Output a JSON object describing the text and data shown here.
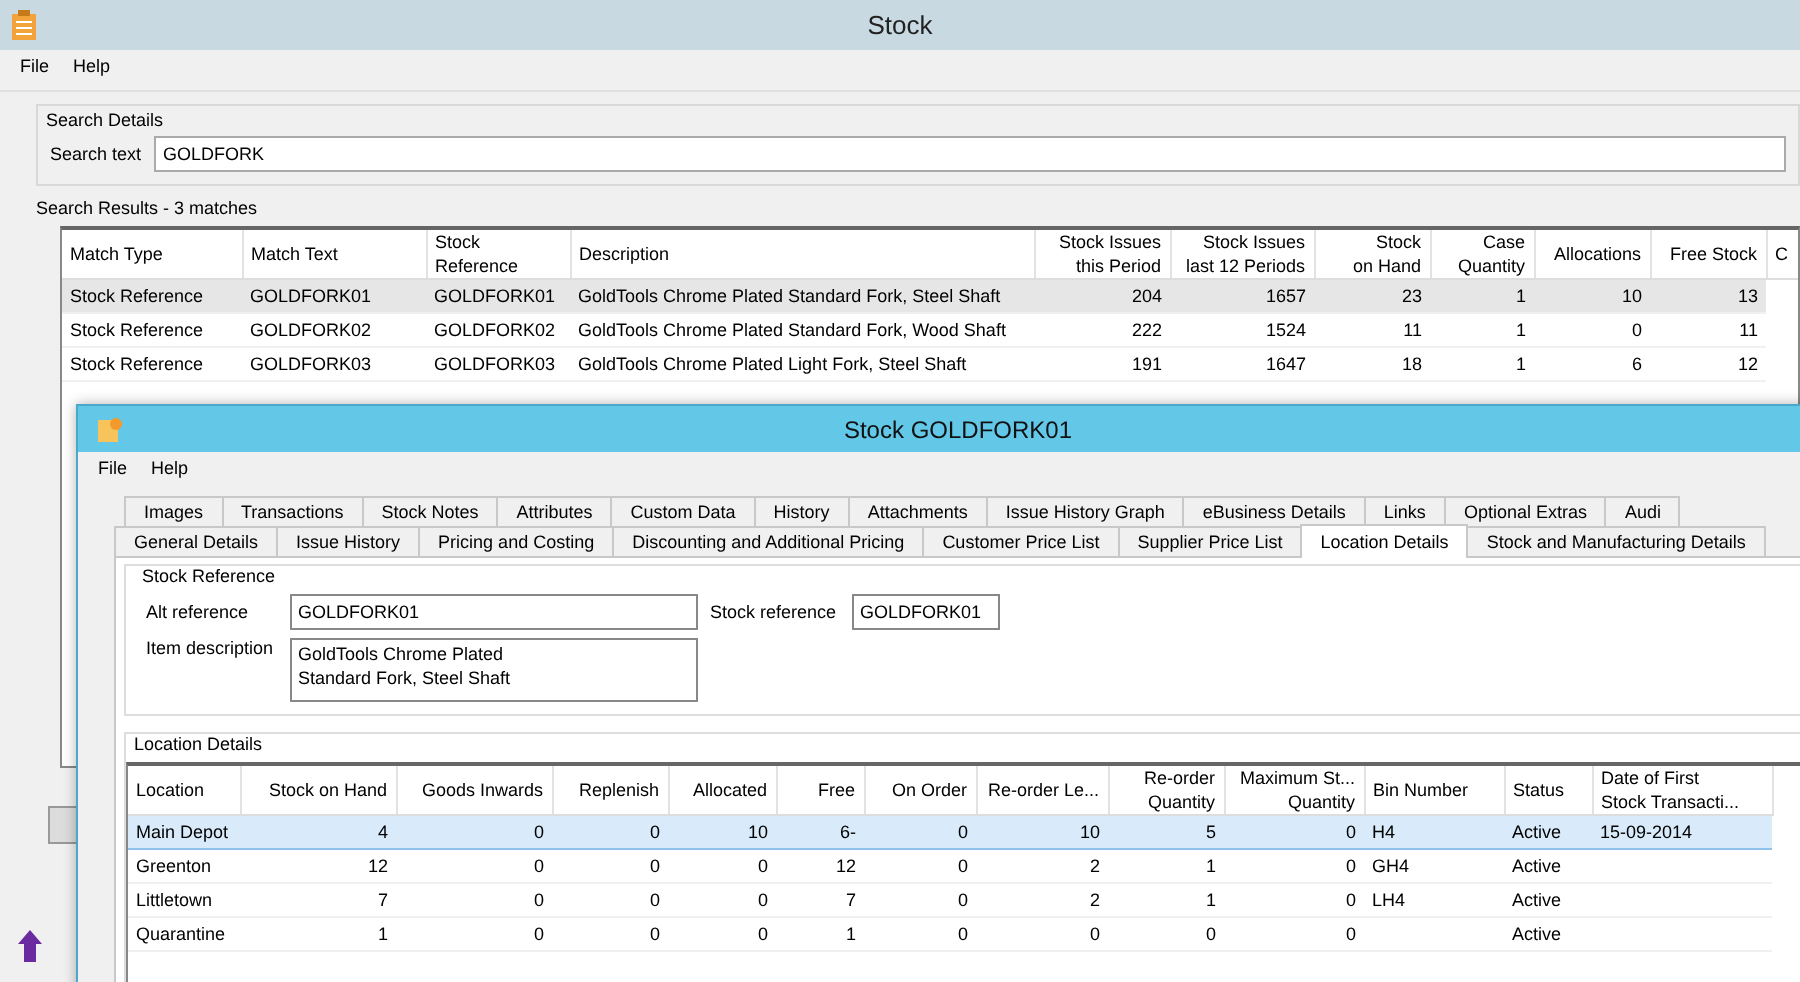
{
  "window": {
    "title": "Stock"
  },
  "menu": [
    "File",
    "Help"
  ],
  "search_details": {
    "title": "Search Details",
    "label": "Search text",
    "value": "GOLDFORK"
  },
  "search_results": {
    "title": "Search Results - 3 matches",
    "columns": [
      {
        "label": "Match Type",
        "kind": "text"
      },
      {
        "label": "Match Text",
        "kind": "text"
      },
      {
        "label": "Stock\nReference",
        "kind": "text"
      },
      {
        "label": "Description",
        "kind": "text"
      },
      {
        "label": "Stock Issues\nthis Period",
        "kind": "number"
      },
      {
        "label": "Stock Issues\nlast 12 Periods",
        "kind": "number"
      },
      {
        "label": "Stock\non Hand",
        "kind": "number"
      },
      {
        "label": "Case\nQuantity",
        "kind": "number"
      },
      {
        "label": "Allocations",
        "kind": "number"
      },
      {
        "label": "Free Stock",
        "kind": "number"
      },
      {
        "label": "C",
        "kind": "text"
      }
    ],
    "rows": [
      {
        "selected": true,
        "cells": [
          "Stock Reference",
          "GOLDFORK01",
          "GOLDFORK01",
          "GoldTools Chrome Plated Standard Fork, Steel Shaft",
          "204",
          "1657",
          "23",
          "1",
          "10",
          "13"
        ]
      },
      {
        "selected": false,
        "cells": [
          "Stock Reference",
          "GOLDFORK02",
          "GOLDFORK02",
          "GoldTools Chrome Plated Standard Fork, Wood Shaft",
          "222",
          "1524",
          "11",
          "1",
          "0",
          "11"
        ]
      },
      {
        "selected": false,
        "cells": [
          "Stock Reference",
          "GOLDFORK03",
          "GOLDFORK03",
          "GoldTools Chrome Plated Light Fork, Steel Shaft",
          "191",
          "1647",
          "18",
          "1",
          "6",
          "12"
        ]
      }
    ]
  },
  "detail_window": {
    "title": "Stock GOLDFORK01",
    "menu": [
      "File",
      "Help"
    ],
    "tab_rows": [
      [
        {
          "label": "Images",
          "selected": false
        },
        {
          "label": "Transactions",
          "selected": false
        },
        {
          "label": "Stock Notes",
          "selected": false
        },
        {
          "label": "Attributes",
          "selected": false
        },
        {
          "label": "Custom Data",
          "selected": false
        },
        {
          "label": "History",
          "selected": false
        },
        {
          "label": "Attachments",
          "selected": false
        },
        {
          "label": "Issue History Graph",
          "selected": false
        },
        {
          "label": "eBusiness Details",
          "selected": false
        },
        {
          "label": "Links",
          "selected": false
        },
        {
          "label": "Optional Extras",
          "selected": false
        },
        {
          "label": "Audi",
          "selected": false
        }
      ],
      [
        {
          "label": "General Details",
          "selected": false
        },
        {
          "label": "Issue History",
          "selected": false
        },
        {
          "label": "Pricing and Costing",
          "selected": false
        },
        {
          "label": "Discounting and Additional Pricing",
          "selected": false
        },
        {
          "label": "Customer Price List",
          "selected": false
        },
        {
          "label": "Supplier Price List",
          "selected": false
        },
        {
          "label": "Location Details",
          "selected": true
        },
        {
          "label": "Stock and Manufacturing Details",
          "selected": false
        }
      ]
    ],
    "stock_reference": {
      "title": "Stock Reference",
      "alt_reference_label": "Alt reference",
      "alt_reference": "GOLDFORK01",
      "stock_reference_label": "Stock reference",
      "stock_reference": "GOLDFORK01",
      "item_description_label": "Item description",
      "item_description": "GoldTools Chrome Plated\nStandard Fork, Steel Shaft"
    },
    "location_details": {
      "title": "Location Details",
      "columns": [
        {
          "label": "Location",
          "kind": "text"
        },
        {
          "label": "Stock on Hand",
          "kind": "number"
        },
        {
          "label": "Goods Inwards",
          "kind": "number"
        },
        {
          "label": "Replenish",
          "kind": "number"
        },
        {
          "label": "Allocated",
          "kind": "number"
        },
        {
          "label": "Free",
          "kind": "number"
        },
        {
          "label": "On Order",
          "kind": "number"
        },
        {
          "label": "Re-order Le...",
          "kind": "number"
        },
        {
          "label": "Re-order\nQuantity",
          "kind": "number"
        },
        {
          "label": "Maximum St...\nQuantity",
          "kind": "number"
        },
        {
          "label": "Bin Number",
          "kind": "text"
        },
        {
          "label": "Status",
          "kind": "text"
        },
        {
          "label": "Date of First\nStock Transacti...",
          "kind": "text"
        }
      ],
      "rows": [
        {
          "selected": true,
          "cells": [
            "Main Depot",
            "4",
            "0",
            "0",
            "10",
            "6-",
            "0",
            "10",
            "5",
            "0",
            "H4",
            "Active",
            "15-09-2014"
          ]
        },
        {
          "selected": false,
          "cells": [
            "Greenton",
            "12",
            "0",
            "0",
            "0",
            "12",
            "0",
            "2",
            "1",
            "0",
            "GH4",
            "Active",
            ""
          ]
        },
        {
          "selected": false,
          "cells": [
            "Littletown",
            "7",
            "0",
            "0",
            "0",
            "7",
            "0",
            "2",
            "1",
            "0",
            "LH4",
            "Active",
            ""
          ]
        },
        {
          "selected": false,
          "cells": [
            "Quarantine",
            "1",
            "0",
            "0",
            "0",
            "1",
            "0",
            "0",
            "0",
            "0",
            "",
            "Active",
            ""
          ]
        }
      ]
    }
  }
}
